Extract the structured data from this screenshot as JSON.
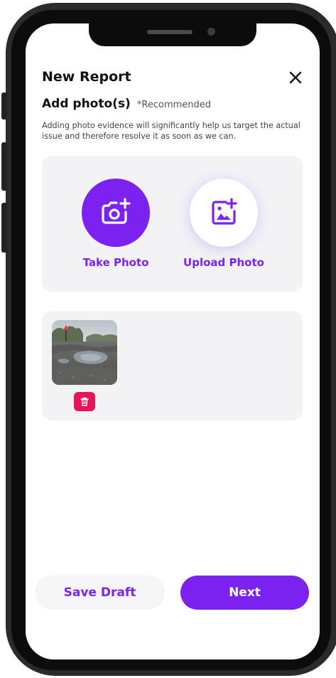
{
  "header": {
    "title": "New Report",
    "close_icon": "close-icon"
  },
  "photo_section": {
    "title": "Add photo(s)",
    "note": "*Recommended",
    "description": "Adding photo evidence will significantly help us target the actual issue and therefore resolve it as soon as we can."
  },
  "capture": {
    "take_photo_label": "Take Photo",
    "take_photo_icon": "camera-add-icon",
    "upload_photo_label": "Upload Photo",
    "upload_photo_icon": "image-add-icon"
  },
  "gallery": {
    "photos": [
      {
        "subject": "pothole-road-photo"
      }
    ],
    "delete_icon": "trash-icon"
  },
  "footer": {
    "save_draft_label": "Save Draft",
    "next_label": "Next"
  },
  "colors": {
    "accent": "#7c22f0",
    "danger": "#e8145a",
    "card_bg": "#f3f3f5",
    "frame": "#2b2b2b"
  }
}
